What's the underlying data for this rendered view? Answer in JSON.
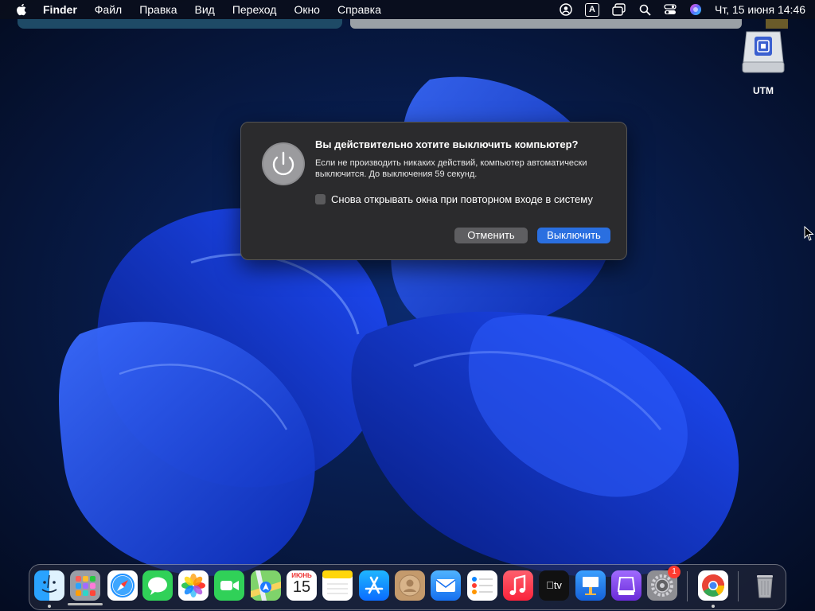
{
  "menubar": {
    "app_name": "Finder",
    "items": [
      "Файл",
      "Правка",
      "Вид",
      "Переход",
      "Окно",
      "Справка"
    ],
    "input_source": "A",
    "datetime": "Чт, 15 июня  14:46"
  },
  "desktop": {
    "icons": [
      {
        "label": "UTM",
        "icon": "drive-icon"
      }
    ]
  },
  "dialog": {
    "title": "Вы действительно хотите выключить компьютер?",
    "message": "Если не производить никаких действий, компьютер автоматически выключится. До выключения 59 секунд.",
    "checkbox_label": "Снова открывать окна при повторном входе в систему",
    "checkbox_checked": false,
    "cancel_label": "Отменить",
    "confirm_label": "Выключить"
  },
  "dock": {
    "calendar_month": "ИЮНЬ",
    "calendar_day": "15",
    "tv_label": "tv",
    "settings_badge": "1",
    "apps": [
      "finder",
      "launchpad",
      "safari",
      "messages",
      "photos",
      "facetime",
      "maps",
      "calendar",
      "notes",
      "app-store",
      "contacts",
      "mail",
      "reminders",
      "music",
      "apple-tv",
      "keynote",
      "podcasts-purple",
      "system-settings",
      "chrome",
      "trash"
    ]
  },
  "colors": {
    "accent": "#2a6fe0",
    "dialog_bg": "#2b2b2d",
    "badge": "#ff3b30"
  }
}
